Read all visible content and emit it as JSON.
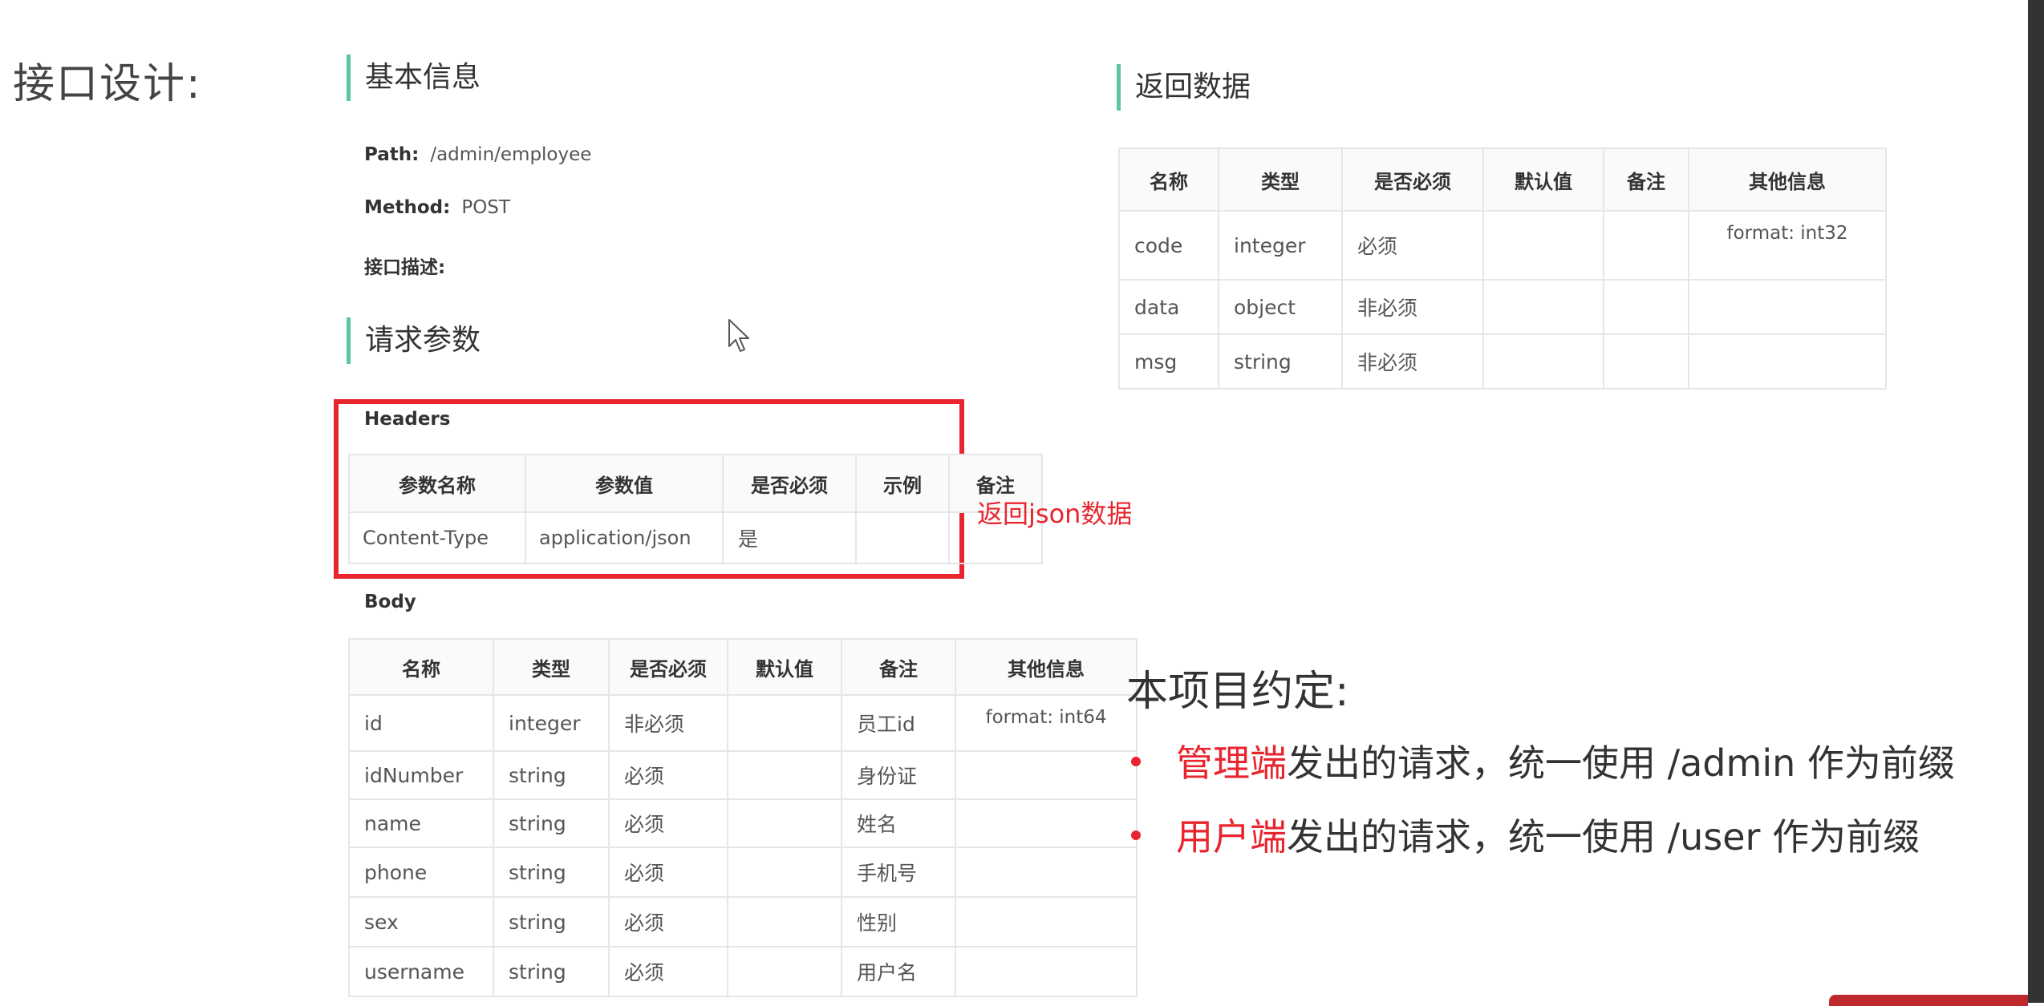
{
  "page_title": "接口设计:",
  "basic_info": {
    "heading": "基本信息",
    "path_label": "Path:",
    "path_value": "/admin/employee",
    "method_label": "Method:",
    "method_value": "POST",
    "desc_label": "接口描述:"
  },
  "request_params": {
    "heading": "请求参数",
    "headers_label": "Headers",
    "headers_table": {
      "columns": [
        "参数名称",
        "参数值",
        "是否必须",
        "示例",
        "备注"
      ],
      "rows": [
        [
          "Content-Type",
          "application/json",
          "是",
          "",
          ""
        ]
      ]
    },
    "annotation": "返回json数据",
    "body_label": "Body",
    "body_table": {
      "columns": [
        "名称",
        "类型",
        "是否必须",
        "默认值",
        "备注",
        "其他信息"
      ],
      "rows": [
        [
          "id",
          "integer",
          "非必须",
          "",
          "员工id",
          "format: int64"
        ],
        [
          "idNumber",
          "string",
          "必须",
          "",
          "身份证",
          ""
        ],
        [
          "name",
          "string",
          "必须",
          "",
          "姓名",
          ""
        ],
        [
          "phone",
          "string",
          "必须",
          "",
          "手机号",
          ""
        ],
        [
          "sex",
          "string",
          "必须",
          "",
          "性别",
          ""
        ],
        [
          "username",
          "string",
          "必须",
          "",
          "用户名",
          ""
        ]
      ]
    }
  },
  "return_data": {
    "heading": "返回数据",
    "table": {
      "columns": [
        "名称",
        "类型",
        "是否必须",
        "默认值",
        "备注",
        "其他信息"
      ],
      "rows": [
        [
          "code",
          "integer",
          "必须",
          "",
          "",
          "format: int32"
        ],
        [
          "data",
          "object",
          "非必须",
          "",
          "",
          ""
        ],
        [
          "msg",
          "string",
          "非必须",
          "",
          "",
          ""
        ]
      ]
    }
  },
  "convention": {
    "title": "本项目约定:",
    "items": [
      {
        "highlight": "管理端",
        "text": "发出的请求，统一使用 /admin 作为前缀"
      },
      {
        "highlight": "用户端",
        "text": "发出的请求，统一使用 /user 作为前缀"
      }
    ]
  },
  "colors": {
    "accent": "#5cc5a8",
    "red": "#e8252e"
  },
  "icons": {
    "cursor": "arrow-cursor-icon"
  }
}
